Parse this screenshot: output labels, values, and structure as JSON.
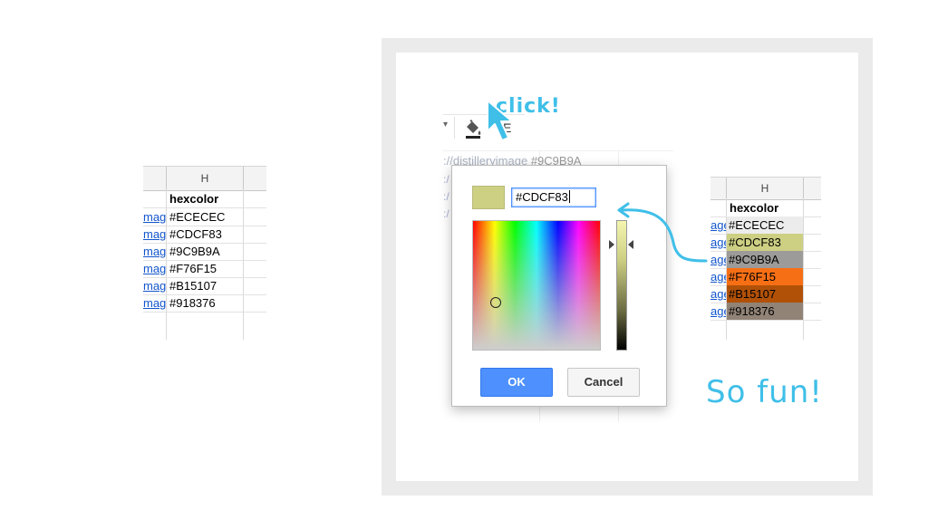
{
  "left_sheet": {
    "column_header": "H",
    "header_value": "hexcolor",
    "link_fragment": "mage",
    "rows": [
      "#ECECEC",
      "#CDCF83",
      "#9C9B9A",
      "#F76F15",
      "#B15107",
      "#918376"
    ]
  },
  "toolbar": {
    "caret": "▾",
    "partial_letter": "E"
  },
  "annotation": {
    "click_label": "click!",
    "fun_label": "So fun!",
    "accent_color": "#3fbfe8"
  },
  "background_sheet": {
    "url_fragment": "://distilleryimage",
    "hex_fragment": "#9C9B9A",
    "link_glyph": ":/"
  },
  "color_dialog": {
    "hex_value": "#CDCF83",
    "swatch_color": "#cdcf83",
    "ok_label": "OK",
    "cancel_label": "Cancel"
  },
  "right_sheet": {
    "column_header": "H",
    "header_value": "hexcolor",
    "link_fragment": "age",
    "rows": [
      {
        "value": "#ECECEC",
        "fill": "#ececec",
        "text_color": "#000000"
      },
      {
        "value": "#CDCF83",
        "fill": "#cdcf83",
        "text_color": "#000000"
      },
      {
        "value": "#9C9B9A",
        "fill": "#9c9b9a",
        "text_color": "#000000"
      },
      {
        "value": "#F76F15",
        "fill": "#f76f15",
        "text_color": "#000000"
      },
      {
        "value": "#B15107",
        "fill": "#b15107",
        "text_color": "#000000"
      },
      {
        "value": "#918376",
        "fill": "#918376",
        "text_color": "#000000"
      }
    ]
  }
}
